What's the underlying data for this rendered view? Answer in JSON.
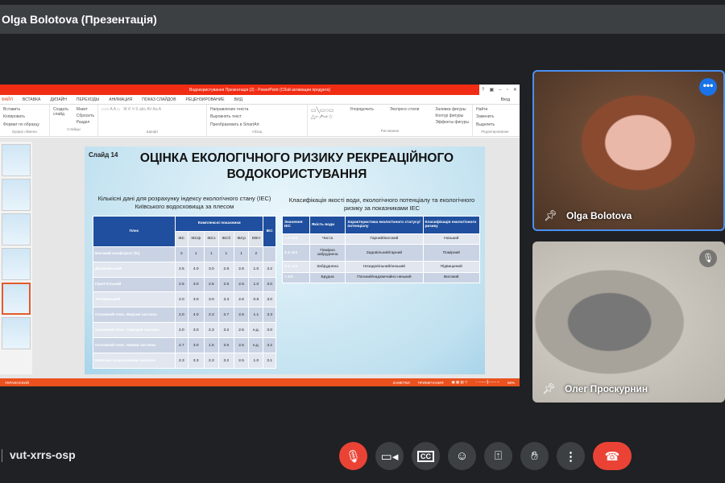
{
  "header": {
    "title": "Olga Bolotova (Презентація)"
  },
  "ppt": {
    "window_title": "Водокористування Презентація (2) - PowerPoint (Сбой активации продукта)",
    "window_controls": [
      "?",
      "▣",
      "–",
      "▫",
      "✕"
    ],
    "account": "Вход",
    "tabs": [
      "ФАЙЛ",
      "ВСТАВКА",
      "ДИЗАЙН",
      "ПЕРЕХОДЫ",
      "АНИМАЦИЯ",
      "ПОКАЗ СЛАЙДОВ",
      "РЕЦЕНЗИРОВАНИЕ",
      "ВИД"
    ],
    "ribbon": {
      "clipboard": [
        "Вставить",
        "Копировать",
        "Формат по образцу"
      ],
      "clipboard_label": "Буфер обмена",
      "slides": [
        "Создать слайд",
        "Макет",
        "Сбросить",
        "Раздел"
      ],
      "slides_label": "Слайды",
      "font_label": "Шрифт",
      "paragraph": [
        "Направление текста",
        "Выровнять текст",
        "Преобразовать в SmartArt"
      ],
      "paragraph_label": "Абзац",
      "drawing": [
        "Упорядочить",
        "Экспресс-стили",
        "Заливка фигуры",
        "Контур фигуры",
        "Эффекты фигуры"
      ],
      "drawing_label": "Рисование",
      "editing": [
        "Найти",
        "Заменить",
        "Выделить"
      ],
      "editing_label": "Редактирование"
    },
    "status": {
      "language": "УКРАИНСКИЙ",
      "notes": "ЗАМЕТКИ",
      "comments": "ПРИМЕЧАНИЯ",
      "zoom": "66%"
    }
  },
  "slide": {
    "number": "Слайд 14",
    "title": "ОЦІНКА ЕКОЛОГІЧНОГО РИЗИКУ РЕКРЕАЦІЙНОГО ВОДОКОРИСТУВАННЯ",
    "left_caption": "Кількісні дані для розрахунку індексу екологічного стану (IEC) Київського водосховища за плесом",
    "right_caption": "Класифікація якості води, екологічного потенціалу та екологічного ризику за показниками IEC",
    "table1": {
      "head1": [
        "Плес",
        "Комплексні показники",
        "IEC"
      ],
      "head2": [
        "IБС",
        "IБСф",
        "IБСз",
        "IБСб",
        "IБСр",
        "ЕВН"
      ],
      "rows": [
        [
          "Ваговий коефіцієнт (ki)",
          "2",
          "1",
          "1",
          "1",
          "1",
          "2",
          ""
        ],
        [
          "Дніпровський",
          "2.5",
          "4.0",
          "3.0",
          "2.8",
          "2.6",
          "1.0",
          "3.2"
        ],
        [
          "Прип'ятський",
          "2.6",
          "3.0",
          "2.5",
          "2.5",
          "2.6",
          "1.0",
          "3.0"
        ],
        [
          "Тетерівський",
          "2.0",
          "3.0",
          "3.0",
          "3.3",
          "2.6",
          "0.9",
          "3.0"
        ],
        [
          "Основний плес. Верхня частина",
          "2.0",
          "4.0",
          "2.3",
          "2.7",
          "2.5",
          "1.1",
          "3.3"
        ],
        [
          "Основний плес. Середня частина",
          "2.0",
          "3.0",
          "2.3",
          "3.2",
          "2.5",
          "н.д.",
          "3.0"
        ],
        [
          "Основний плес. Нижня частина",
          "2.7",
          "3.0",
          "1.5",
          "3.5",
          "2.5",
          "н.д.",
          "3.2"
        ],
        [
          "Київське водосховище загалом",
          "2.3",
          "3.3",
          "2.3",
          "3.2",
          "2.5",
          "1.0",
          "3.1"
        ]
      ]
    },
    "table2": {
      "head": [
        "Значення IEC",
        "Якість води",
        "Характеристика екологічного статусу/потенціалу",
        "Класифікація екологічного ризику"
      ],
      "rows": [
        [
          "1.0–2.0",
          "Чиста",
          "Гарний/високий",
          "Низький"
        ],
        [
          "2.1–3.0",
          "Помірно забруднена",
          "Задовільний/гарний",
          "Помірний"
        ],
        [
          "3.1–4.0",
          "Забруднена",
          "Незадовільний/низький",
          "Підвищений"
        ],
        [
          "> 4.0",
          "Брудна",
          "Поганий/надзвичайно низький",
          "Високий"
        ]
      ]
    }
  },
  "participants": [
    {
      "name": "Olga Bolotova"
    },
    {
      "name": "Олег Проскурнин"
    }
  ],
  "meeting": {
    "code": "vut-xrrs-osp"
  },
  "colors": {
    "accent": "#1a73e8",
    "danger": "#ea4335",
    "ppt_red": "#f02d14"
  }
}
